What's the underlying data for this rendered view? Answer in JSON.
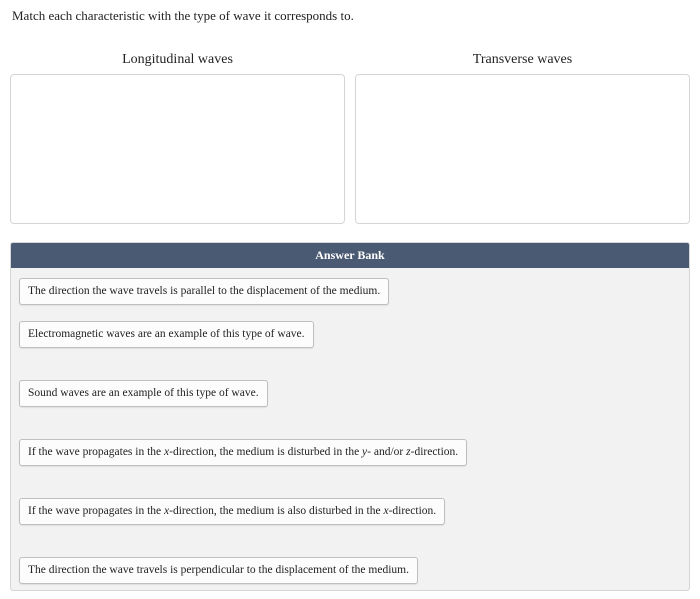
{
  "question": "Match each characteristic with the type of wave it corresponds to.",
  "dropzones": [
    {
      "label": "Longitudinal waves"
    },
    {
      "label": "Transverse waves"
    }
  ],
  "answer_bank_title": "Answer Bank",
  "answers": [
    {
      "text": "The direction the wave travels is parallel to the displacement of the medium."
    },
    {
      "text": "Electromagnetic waves are an example of this type of wave."
    },
    {
      "text": "Sound waves are an example of this type of wave."
    },
    {
      "html_parts": [
        "If the wave propagates in the ",
        "x",
        "-direction, the medium is disturbed in the ",
        "y",
        "- and/or ",
        "z",
        "-direction."
      ]
    },
    {
      "html_parts": [
        "If the wave propagates in the ",
        "x",
        "-direction, the medium is also disturbed in the ",
        "x",
        "-direction."
      ]
    },
    {
      "text": "The direction the wave travels is perpendicular to the displacement of the medium."
    }
  ]
}
